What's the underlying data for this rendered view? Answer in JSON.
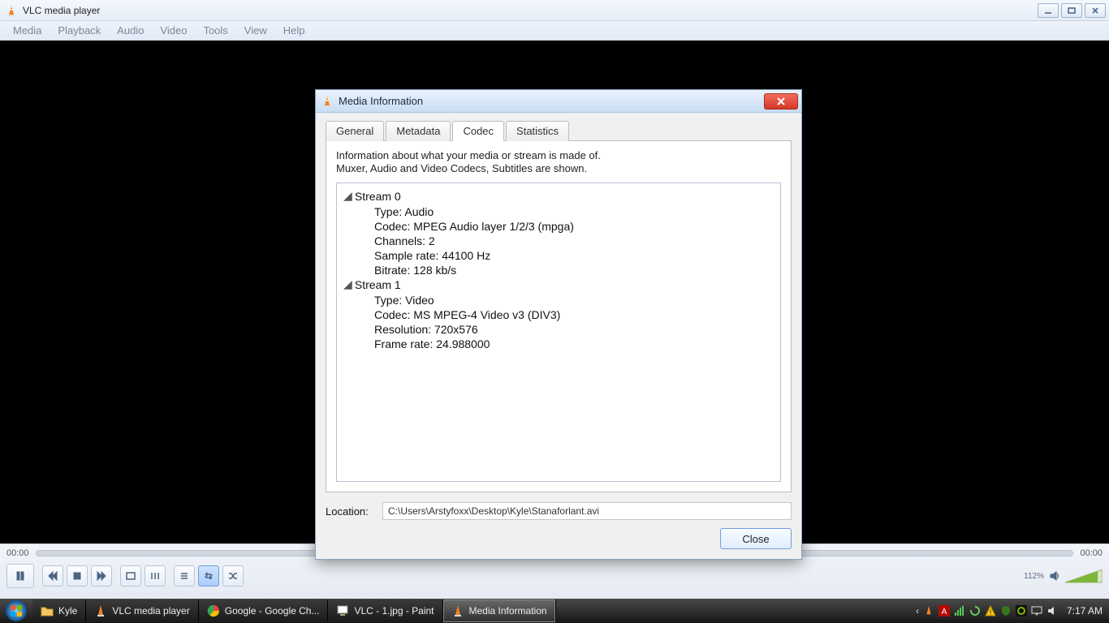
{
  "window": {
    "title": "VLC media player",
    "menu": [
      "Media",
      "Playback",
      "Audio",
      "Video",
      "Tools",
      "View",
      "Help"
    ]
  },
  "seekbar": {
    "elapsed": "00:00",
    "total": "00:00"
  },
  "volume": {
    "percent_label": "112%"
  },
  "dialog": {
    "title": "Media Information",
    "tabs": {
      "general": "General",
      "metadata": "Metadata",
      "codec": "Codec",
      "statistics": "Statistics"
    },
    "desc_line1": "Information about what your media or stream is made of.",
    "desc_line2": "Muxer, Audio and Video Codecs, Subtitles are shown.",
    "streams": [
      {
        "name": "Stream 0",
        "rows": [
          "Type: Audio",
          "Codec: MPEG Audio layer 1/2/3 (mpga)",
          "Channels: 2",
          "Sample rate: 44100 Hz",
          "Bitrate: 128 kb/s"
        ]
      },
      {
        "name": "Stream 1",
        "rows": [
          "Type: Video",
          "Codec: MS MPEG-4 Video v3 (DIV3)",
          "Resolution: 720x576",
          "Frame rate: 24.988000"
        ]
      }
    ],
    "location_label": "Location:",
    "location_value": "C:\\Users\\Arstyfoxx\\Desktop\\Kyle\\Stanaforlant.avi",
    "close_label": "Close"
  },
  "taskbar": {
    "items": [
      {
        "label": "Kyle"
      },
      {
        "label": "VLC media player"
      },
      {
        "label": "Google - Google Ch..."
      },
      {
        "label": "VLC - 1.jpg - Paint"
      },
      {
        "label": "Media Information"
      }
    ],
    "clock": "7:17 AM"
  }
}
